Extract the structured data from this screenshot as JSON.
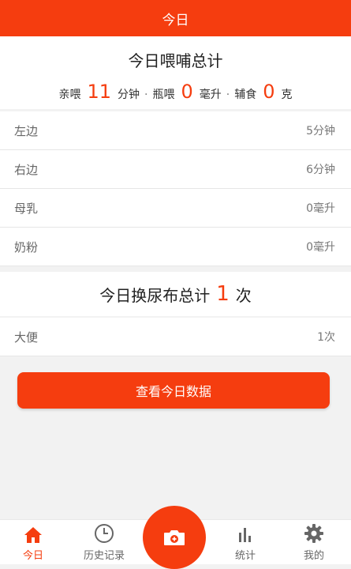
{
  "header": {
    "title": "今日"
  },
  "feeding": {
    "title": "今日喂哺总计",
    "breast_label": "亲喂",
    "breast_value": "11",
    "breast_unit": "分钟",
    "bottle_label": "瓶喂",
    "bottle_value": "0",
    "bottle_unit": "毫升",
    "solid_label": "辅食",
    "solid_value": "0",
    "solid_unit": "克",
    "separator": "·",
    "rows": [
      {
        "label": "左边",
        "value": "5分钟"
      },
      {
        "label": "右边",
        "value": "6分钟"
      },
      {
        "label": "母乳",
        "value": "0毫升"
      },
      {
        "label": "奶粉",
        "value": "0毫升"
      }
    ]
  },
  "diaper": {
    "title_prefix": "今日换尿布总计",
    "count": "1",
    "title_suffix": "次",
    "rows": [
      {
        "label": "大便",
        "value": "1次"
      }
    ]
  },
  "view_button": "查看今日数据",
  "tabs": [
    {
      "label": "今日",
      "icon": "home-icon",
      "active": true
    },
    {
      "label": "历史记录",
      "icon": "clock-icon",
      "active": false
    },
    {
      "label": "",
      "icon": "camera-icon",
      "active": false
    },
    {
      "label": "统计",
      "icon": "bar-chart-icon",
      "active": false
    },
    {
      "label": "我的",
      "icon": "gear-icon",
      "active": false
    }
  ],
  "colors": {
    "accent": "#f53d0f",
    "background": "#f2f2f2"
  }
}
